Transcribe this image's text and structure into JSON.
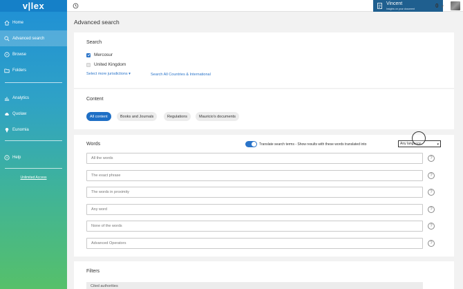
{
  "sidebar": {
    "logo": "v|lex",
    "items": [
      {
        "label": "Home",
        "icon": "home-icon"
      },
      {
        "label": "Advanced search",
        "icon": "search-icon"
      },
      {
        "label": "Browse",
        "icon": "compass-icon"
      },
      {
        "label": "Folders",
        "icon": "folder-icon"
      }
    ],
    "items2": [
      {
        "label": "Analytics",
        "icon": "chart-icon"
      },
      {
        "label": "Quolaw",
        "icon": "cloud-icon"
      },
      {
        "label": "Eunomia",
        "icon": "lightbulb-icon"
      }
    ],
    "help": {
      "label": "Help",
      "icon": "help-icon"
    },
    "access_link": "Unlimited Access"
  },
  "topbar": {
    "user_name": "Vincent",
    "user_subtitle": "Insights on your document",
    "count": "0"
  },
  "page_title": "Advanced search",
  "search": {
    "title": "Search",
    "jurisdictions": [
      {
        "label": "Mercosur",
        "checked": true
      },
      {
        "label": "United Kingdom",
        "checked": false
      }
    ],
    "select_more": "Select more jurisdictions",
    "search_all": "Search All Countries & International"
  },
  "content": {
    "title": "Content",
    "chips": [
      "All content",
      "Books and Journals",
      "Regulations",
      "Mauricio's documents"
    ]
  },
  "words": {
    "title": "Words",
    "translate_label": "Translate search terms - Show results with these words translated into",
    "language_value": "Any language",
    "fields": [
      {
        "placeholder": "All the words"
      },
      {
        "placeholder": "The exact phrase"
      },
      {
        "placeholder": "The words in proximity"
      },
      {
        "placeholder": "Any word"
      },
      {
        "placeholder": "None of the words"
      },
      {
        "placeholder": "Advanced Operators"
      }
    ]
  },
  "filters": {
    "title": "Filters",
    "first_field": "Cited authorities"
  },
  "colors": {
    "accent": "#2a74c9",
    "sidebar_top": "#1f8fd6",
    "sidebar_bottom": "#56c06a"
  }
}
